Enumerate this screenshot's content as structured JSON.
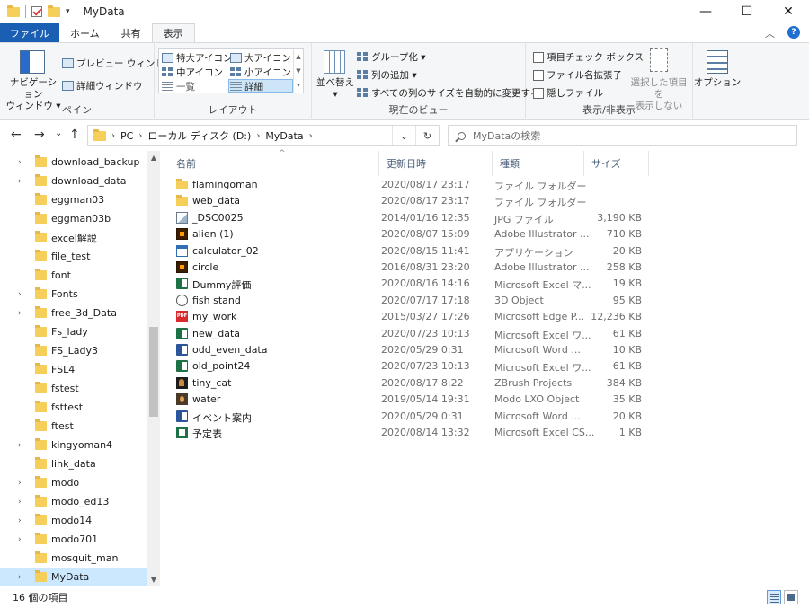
{
  "window": {
    "title": "MyData",
    "minimize": "—",
    "maximize": "☐",
    "close": "✕"
  },
  "ribbon_tabs": [
    {
      "label": "ファイル"
    },
    {
      "label": "ホーム"
    },
    {
      "label": "共有"
    },
    {
      "label": "表示"
    }
  ],
  "ribbon_right": {
    "collapse": "︿",
    "help": "?"
  },
  "ribbon": {
    "pane": {
      "label": "ペイン",
      "nav_pane_line1": "ナビゲーション",
      "nav_pane_line2": "ウィンドウ ▾",
      "preview": "プレビュー ウィンドウ",
      "details_pane": "詳細ウィンドウ"
    },
    "layout": {
      "label": "レイアウト",
      "extra_large": "特大アイコン",
      "large": "大アイコン",
      "medium": "中アイコン",
      "small": "小アイコン",
      "list": "一覧",
      "details": "詳細"
    },
    "current_view": {
      "label": "現在のビュー",
      "sort_line1": "並べ替え",
      "sort_line2": "▾",
      "group_by": "グループ化 ▾",
      "add_columns": "列の追加 ▾",
      "fit_columns": "すべての列のサイズを自動的に変更する"
    },
    "show_hide": {
      "label": "表示/非表示",
      "item_checkboxes": "項目チェック ボックス",
      "file_extensions": "ファイル名拡張子",
      "hidden_items": "隠しファイル",
      "hide_selected_line1": "選択した項目を",
      "hide_selected_line2": "表示しない"
    },
    "options": {
      "label": "オプション"
    }
  },
  "nav": {
    "back": "←",
    "forward": "→",
    "recent": "⌄",
    "up": "↑",
    "breadcrumb": [
      "PC",
      "ローカル ディスク (D:)",
      "MyData"
    ],
    "crumb_sep": "›",
    "dropdown": "⌄",
    "refresh": "↻",
    "search_placeholder": "MyDataの検索"
  },
  "sidebar": {
    "items": [
      {
        "label": "download_backup",
        "chevron": "›"
      },
      {
        "label": "download_data",
        "chevron": "›"
      },
      {
        "label": "eggman03",
        "chevron": ""
      },
      {
        "label": "eggman03b",
        "chevron": ""
      },
      {
        "label": "excel解説",
        "chevron": ""
      },
      {
        "label": "file_test",
        "chevron": ""
      },
      {
        "label": "font",
        "chevron": ""
      },
      {
        "label": "Fonts",
        "chevron": "›"
      },
      {
        "label": "free_3d_Data",
        "chevron": "›"
      },
      {
        "label": "Fs_lady",
        "chevron": ""
      },
      {
        "label": "FS_Lady3",
        "chevron": ""
      },
      {
        "label": "FSL4",
        "chevron": ""
      },
      {
        "label": "fstest",
        "chevron": ""
      },
      {
        "label": "fsttest",
        "chevron": ""
      },
      {
        "label": "ftest",
        "chevron": ""
      },
      {
        "label": "kingyoman4",
        "chevron": "›"
      },
      {
        "label": "link_data",
        "chevron": ""
      },
      {
        "label": "modo",
        "chevron": "›"
      },
      {
        "label": "modo_ed13",
        "chevron": "›"
      },
      {
        "label": "modo14",
        "chevron": "›"
      },
      {
        "label": "modo701",
        "chevron": "›"
      },
      {
        "label": "mosquit_man",
        "chevron": ""
      },
      {
        "label": "MyData",
        "chevron": "›"
      }
    ]
  },
  "columns": {
    "name": "名前",
    "date": "更新日時",
    "type": "種類",
    "size": "サイズ",
    "sort_indicator": "^"
  },
  "files": [
    {
      "name": "flamingoman",
      "date": "2020/08/17 23:17",
      "type": "ファイル フォルダー",
      "size": "",
      "icon": "folder-icon"
    },
    {
      "name": "web_data",
      "date": "2020/08/17 23:17",
      "type": "ファイル フォルダー",
      "size": "",
      "icon": "folder-icon"
    },
    {
      "name": "_DSC0025",
      "date": "2014/01/16 12:35",
      "type": "JPG ファイル",
      "size": "3,190 KB",
      "icon": "image-file-icon"
    },
    {
      "name": "alien (1)",
      "date": "2020/08/07 15:09",
      "type": "Adobe Illustrator ...",
      "size": "710 KB",
      "icon": "illustrator-file-icon"
    },
    {
      "name": "calculator_02",
      "date": "2020/08/15 11:41",
      "type": "アプリケーション",
      "size": "20 KB",
      "icon": "application-icon"
    },
    {
      "name": "circle",
      "date": "2016/08/31 23:20",
      "type": "Adobe Illustrator ...",
      "size": "258 KB",
      "icon": "illustrator-file-icon"
    },
    {
      "name": "Dummy評価",
      "date": "2020/08/16 14:16",
      "type": "Microsoft Excel マ...",
      "size": "19 KB",
      "icon": "excel-file-icon"
    },
    {
      "name": "fish stand",
      "date": "2020/07/17 17:18",
      "type": "3D Object",
      "size": "95 KB",
      "icon": "3d-object-icon"
    },
    {
      "name": "my_work",
      "date": "2015/03/27 17:26",
      "type": "Microsoft Edge P...",
      "size": "12,236 KB",
      "icon": "pdf-file-icon"
    },
    {
      "name": "new_data",
      "date": "2020/07/23 10:13",
      "type": "Microsoft Excel ワ...",
      "size": "61 KB",
      "icon": "excel-file-icon"
    },
    {
      "name": "odd_even_data",
      "date": "2020/05/29 0:31",
      "type": "Microsoft Word ...",
      "size": "10 KB",
      "icon": "word-file-icon"
    },
    {
      "name": "old_point24",
      "date": "2020/07/23 10:13",
      "type": "Microsoft Excel ワ...",
      "size": "61 KB",
      "icon": "excel-file-icon"
    },
    {
      "name": "tiny_cat",
      "date": "2020/08/17 8:22",
      "type": "ZBrush Projects",
      "size": "384 KB",
      "icon": "zbrush-file-icon"
    },
    {
      "name": "water",
      "date": "2019/05/14 19:31",
      "type": "Modo LXO Object",
      "size": "35 KB",
      "icon": "modo-file-icon"
    },
    {
      "name": "イベント案内",
      "date": "2020/05/29 0:31",
      "type": "Microsoft Word ...",
      "size": "20 KB",
      "icon": "word-file-icon"
    },
    {
      "name": "予定表",
      "date": "2020/08/14 13:32",
      "type": "Microsoft Excel CS...",
      "size": "1 KB",
      "icon": "csv-file-icon"
    }
  ],
  "status": {
    "item_count": "16 個の項目"
  }
}
